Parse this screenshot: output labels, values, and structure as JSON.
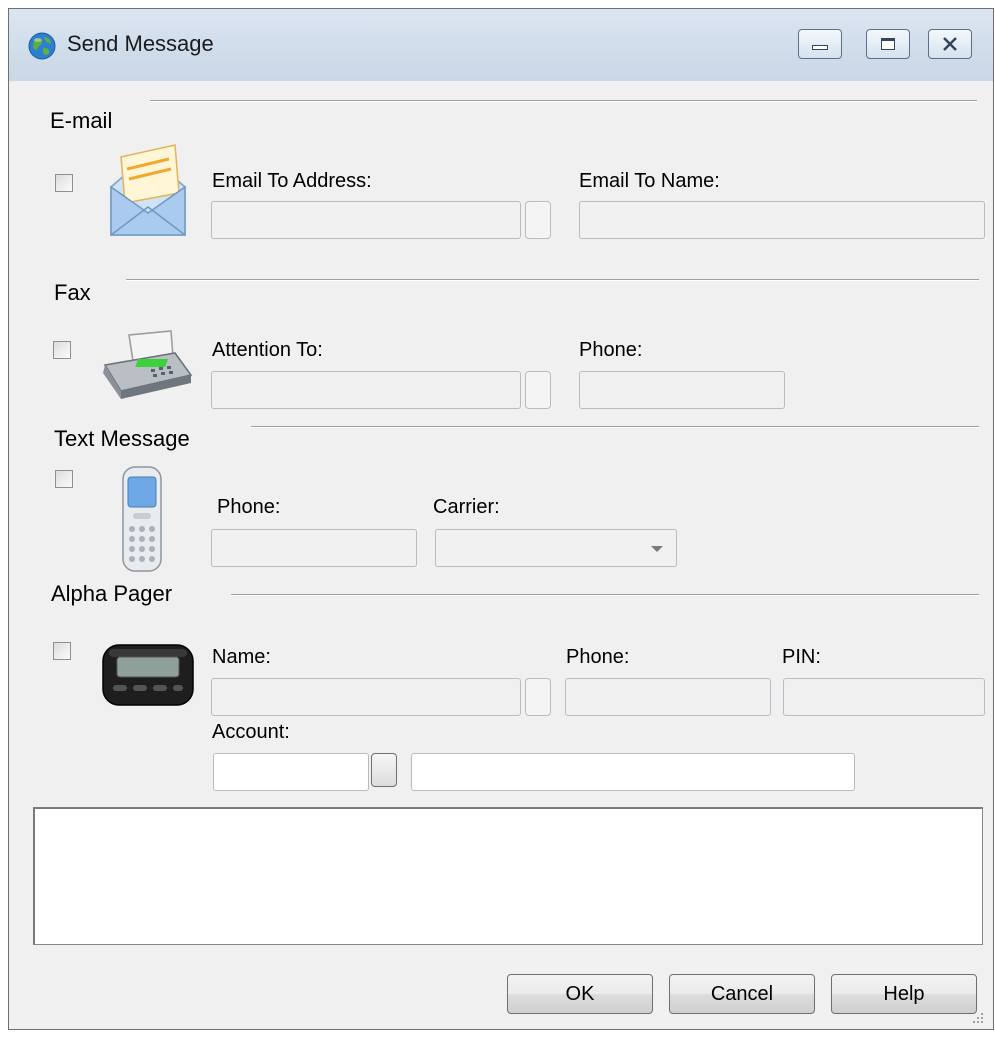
{
  "window": {
    "title": "Send Message"
  },
  "email": {
    "section_title": "E-mail",
    "address_label": "Email To Address:",
    "address_value": "",
    "name_label": "Email To Name:",
    "name_value": "",
    "icon": "envelope-icon"
  },
  "fax": {
    "section_title": "Fax",
    "attention_label": "Attention To:",
    "attention_value": "",
    "phone_label": "Phone:",
    "phone_value": "",
    "icon": "fax-machine-icon"
  },
  "text_message": {
    "section_title": "Text Message",
    "phone_label": "Phone:",
    "phone_value": "",
    "carrier_label": "Carrier:",
    "carrier_value": "",
    "icon": "mobile-phone-icon"
  },
  "alpha_pager": {
    "section_title": "Alpha Pager",
    "name_label": "Name:",
    "name_value": "",
    "phone_label": "Phone:",
    "phone_value": "",
    "pin_label": "PIN:",
    "pin_value": "",
    "account_label": "Account:",
    "account_value": "",
    "account_name_value": "",
    "icon": "pager-icon"
  },
  "message_text": "",
  "buttons": {
    "ok": "OK",
    "cancel": "Cancel",
    "help": "Help"
  },
  "colors": {
    "titlebar": "#cfdcea",
    "client": "#f0f0f0",
    "disabled_field": "#f0f0f0"
  }
}
